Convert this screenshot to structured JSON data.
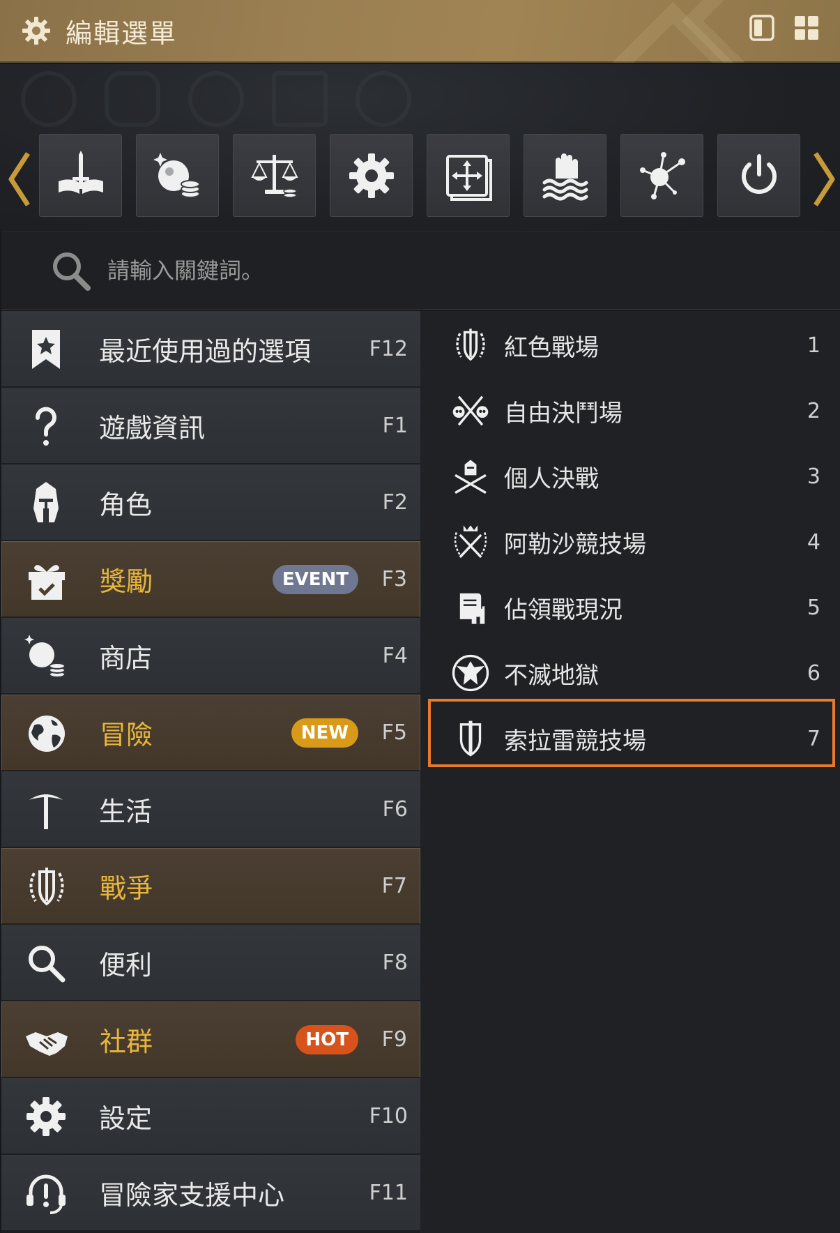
{
  "window": {
    "title": "編輯選單",
    "title_icon": "gear-icon",
    "buttons": [
      {
        "name": "single-panel-view-button",
        "icon": "single-panel-icon"
      },
      {
        "name": "grid-view-button",
        "icon": "grid-icon"
      }
    ]
  },
  "toolbar": {
    "items": [
      {
        "name": "guide-book",
        "icon": "sword-book-icon"
      },
      {
        "name": "shop",
        "icon": "pearl-coins-icon"
      },
      {
        "name": "market",
        "icon": "scales-icon"
      },
      {
        "name": "settings",
        "icon": "gear-icon"
      },
      {
        "name": "move-ui",
        "icon": "move-frame-icon"
      },
      {
        "name": "idle",
        "icon": "hand-waves-icon"
      },
      {
        "name": "network",
        "icon": "node-network-icon"
      },
      {
        "name": "power",
        "icon": "power-icon"
      }
    ]
  },
  "search": {
    "placeholder": "請輸入關鍵詞。",
    "value": ""
  },
  "menu": [
    {
      "label": "最近使用過的選項",
      "key": "F12",
      "icon": "bookmark-star-icon",
      "highlight": false,
      "badge": ""
    },
    {
      "label": "遊戲資訊",
      "key": "F1",
      "icon": "question-icon",
      "highlight": false,
      "badge": ""
    },
    {
      "label": "角色",
      "key": "F2",
      "icon": "helmet-icon",
      "highlight": false,
      "badge": ""
    },
    {
      "label": "獎勵",
      "key": "F3",
      "icon": "gift-icon",
      "highlight": true,
      "badge": "EVENT"
    },
    {
      "label": "商店",
      "key": "F4",
      "icon": "pearl-coins-icon",
      "highlight": false,
      "badge": ""
    },
    {
      "label": "冒險",
      "key": "F5",
      "icon": "globe-icon",
      "highlight": true,
      "badge": "NEW"
    },
    {
      "label": "生活",
      "key": "F6",
      "icon": "pickaxe-icon",
      "highlight": false,
      "badge": ""
    },
    {
      "label": "戰爭",
      "key": "F7",
      "icon": "shield-laurel-icon",
      "highlight": true,
      "badge": ""
    },
    {
      "label": "便利",
      "key": "F8",
      "icon": "magnifier-icon",
      "highlight": false,
      "badge": ""
    },
    {
      "label": "社群",
      "key": "F9",
      "icon": "handshake-icon",
      "highlight": true,
      "badge": "HOT"
    },
    {
      "label": "設定",
      "key": "F10",
      "icon": "gear-icon",
      "highlight": false,
      "badge": ""
    },
    {
      "label": "冒險家支援中心",
      "key": "F11",
      "icon": "support-headset-icon",
      "highlight": false,
      "badge": ""
    }
  ],
  "submenu": {
    "selected_index": 6,
    "items": [
      {
        "label": "紅色戰場",
        "key": "1",
        "icon": "shield-laurel-icon"
      },
      {
        "label": "自由決鬥場",
        "key": "2",
        "icon": "crossed-swords-skulls-icon"
      },
      {
        "label": "個人決戰",
        "key": "3",
        "icon": "knight-crossed-swords-icon"
      },
      {
        "label": "阿勒沙競技場",
        "key": "4",
        "icon": "crowned-swords-icon"
      },
      {
        "label": "佔領戰現況",
        "key": "5",
        "icon": "scroll-tower-icon"
      },
      {
        "label": "不滅地獄",
        "key": "6",
        "icon": "eagle-emblem-icon"
      },
      {
        "label": "索拉雷競技場",
        "key": "7",
        "icon": "sword-shield-icon"
      }
    ]
  },
  "colors": {
    "title_bar": "#9a7f52",
    "highlight_text": "#e8b63c",
    "selection_border": "#e87a2a",
    "badge_event": "#6f7890",
    "badge_new": "#d99a1a",
    "badge_hot": "#d8531c"
  }
}
